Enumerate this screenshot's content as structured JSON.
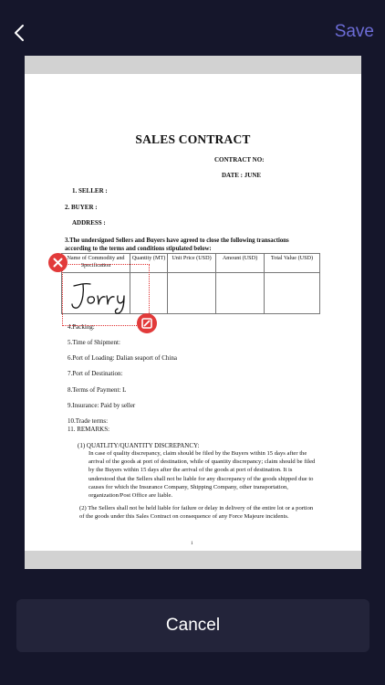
{
  "toolbar": {
    "save_label": "Save"
  },
  "document": {
    "title": "SALES CONTRACT",
    "contract_no": "CONTRACT NO:",
    "date": "DATE : JUNE",
    "seller": "1. SELLER :",
    "buyer": "2. BUYER :",
    "address": "ADDRESS :",
    "clause3_line1": "3.The undersigned Sellers and Buyers have agreed to close the following transactions",
    "clause3_line2": "according to the terms and conditions stipulated below:",
    "table": {
      "headers": [
        "Name of Commodity and Specification",
        "Quantity (MT)",
        "Unit Price (USD)",
        "Amount (USD)",
        "Total Value (USD)"
      ]
    },
    "packing": "4.Packing:",
    "shipment": "5.Time of Shipment:",
    "port_loading": "6.Port of Loading: Dalian seaport of China",
    "port_destination": "7.Port of Destination:",
    "payment": "8.Terms of Payment: L",
    "insurance": "9.Insurance: Paid by seller",
    "trade_terms": "10.Trade terms:",
    "remarks": "11. REMARKS:",
    "remark1_title": "(1) QUATLITY/QUANTITY DISCREPANCY:",
    "remark1_body": "In case of quality discrepancy, claim should be filed by the Buyers within 15 days after the arrival of the goods at port of destination, while of quantity discrepancy; claim should be filed by the Buyers within 15 days after the arrival of the goods at port of destination. It is understood that the Sellers shall not be liable for any discrepancy of the goods shipped due to causes for which the Insurance Company, Shipping Company, other transportation, organization/Post Office are liable.",
    "remark2": "(2) The Sellers shall not be held liable for failure or delay in delivery of the entire lot or a portion of the goods under this Sales Contract on consequence of any Force Majeure incidents.",
    "page_number": "1"
  },
  "signature": {
    "text": "Jorry"
  },
  "footer": {
    "cancel_label": "Cancel"
  },
  "colors": {
    "background": "#15162b",
    "accent": "#6c6cd6",
    "danger": "#e23a3a",
    "button": "#23243a"
  },
  "icons": [
    "back-chevron-icon",
    "delete-icon",
    "resize-icon"
  ]
}
